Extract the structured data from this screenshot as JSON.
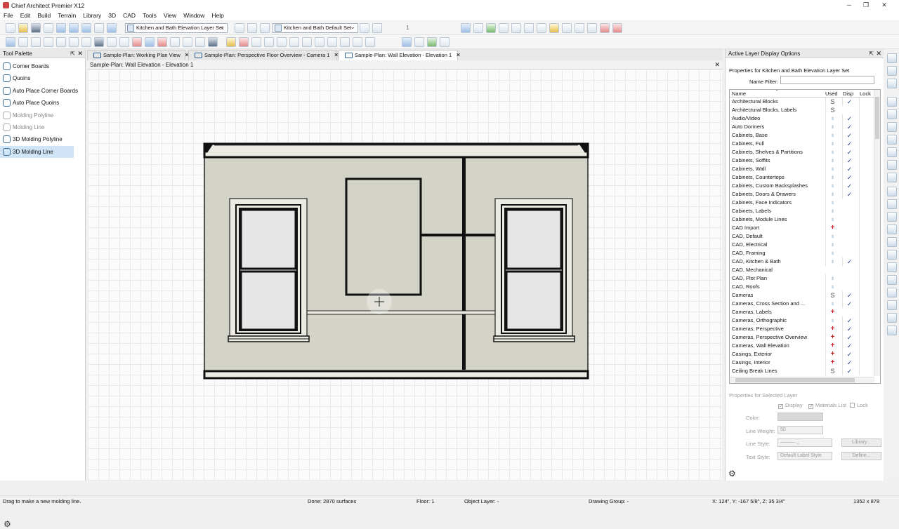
{
  "app": {
    "title": "Chief Architect Premier X12"
  },
  "menu": [
    "File",
    "Edit",
    "Build",
    "Terrain",
    "Library",
    "3D",
    "CAD",
    "Tools",
    "View",
    "Window",
    "Help"
  ],
  "toolbar": {
    "layer_set": "Kitchen and Bath Elevation Layer Set",
    "default_set": "Kitchen and Bath Default Set",
    "counter": "1"
  },
  "tool_palette": {
    "title": "Tool Palette",
    "items": [
      {
        "label": "Corner Boards",
        "state": "normal"
      },
      {
        "label": "Quoins",
        "state": "normal"
      },
      {
        "label": "Auto Place Corner Boards",
        "state": "normal"
      },
      {
        "label": "Auto Place Quoins",
        "state": "normal"
      },
      {
        "label": "Molding Polyline",
        "state": "disabled"
      },
      {
        "label": "Molding Line",
        "state": "disabled"
      },
      {
        "label": "3D Molding Polyline",
        "state": "normal"
      },
      {
        "label": "3D Molding Line",
        "state": "selected"
      }
    ]
  },
  "tabs": [
    {
      "label": "Sample-Plan: Working Plan View",
      "active": false
    },
    {
      "label": "Sample-Plan: Perspective Floor Overview - Camera 1",
      "active": false
    },
    {
      "label": "Sample-Plan: Wall Elevation - Elevation 1",
      "active": true
    }
  ],
  "view": {
    "title": "Sample-Plan: Wall Elevation - Elevation 1"
  },
  "layer_panel": {
    "title": "Active Layer Display Options",
    "properties_label": "Properties for Kitchen and Bath Elevation Layer Set",
    "name_filter_label": "Name Filter:",
    "name_filter_value": "",
    "columns": {
      "name": "Name",
      "used": "Used",
      "disp": "Disp",
      "lock": "Lock"
    },
    "rows": [
      {
        "name": "Architectural Blocks",
        "used": "S",
        "disp": true
      },
      {
        "name": "Architectural Blocks, Labels",
        "used": "S",
        "disp": false
      },
      {
        "name": "Audio/Video",
        "used": "bulb",
        "disp": true
      },
      {
        "name": "Auto Dormers",
        "used": "bulb",
        "disp": true
      },
      {
        "name": "Cabinets,  Base",
        "used": "bulb",
        "disp": true
      },
      {
        "name": "Cabinets,  Full",
        "used": "bulb",
        "disp": true
      },
      {
        "name": "Cabinets,  Shelves & Partitions",
        "used": "bulb",
        "disp": true
      },
      {
        "name": "Cabinets,  Soffits",
        "used": "bulb",
        "disp": true
      },
      {
        "name": "Cabinets,  Wall",
        "used": "bulb",
        "disp": true
      },
      {
        "name": "Cabinets, Countertops",
        "used": "bulb",
        "disp": true
      },
      {
        "name": "Cabinets, Custom Backsplashes",
        "used": "bulb",
        "disp": true
      },
      {
        "name": "Cabinets, Doors & Drawers",
        "used": "bulb",
        "disp": true
      },
      {
        "name": "Cabinets, Face Indicators",
        "used": "bulb",
        "disp": false
      },
      {
        "name": "Cabinets, Labels",
        "used": "bulb",
        "disp": false
      },
      {
        "name": "Cabinets, Module Lines",
        "used": "bulb",
        "disp": false
      },
      {
        "name": "CAD Import",
        "used": "plus",
        "disp": false
      },
      {
        "name": "CAD,  Default",
        "used": "bulb",
        "disp": false
      },
      {
        "name": "CAD, Electrical",
        "used": "bulb",
        "disp": false
      },
      {
        "name": "CAD, Framing",
        "used": "bulb",
        "disp": false
      },
      {
        "name": "CAD, Kitchen & Bath",
        "used": "bulb",
        "disp": true
      },
      {
        "name": "CAD, Mechanical",
        "used": "",
        "disp": false
      },
      {
        "name": "CAD, Plot Plan",
        "used": "bulb",
        "disp": false
      },
      {
        "name": "CAD, Roofs",
        "used": "bulb",
        "disp": false
      },
      {
        "name": "Cameras",
        "used": "S",
        "disp": true
      },
      {
        "name": "Cameras, Cross Section and ...",
        "used": "bulb",
        "disp": true
      },
      {
        "name": "Cameras, Labels",
        "used": "plus",
        "disp": false
      },
      {
        "name": "Cameras, Orthographic",
        "used": "bulb",
        "disp": true
      },
      {
        "name": "Cameras, Perspective",
        "used": "plus",
        "disp": true
      },
      {
        "name": "Cameras, Perspective Overview",
        "used": "plus",
        "disp": true
      },
      {
        "name": "Cameras, Wall Elevation",
        "used": "plus",
        "disp": true
      },
      {
        "name": "Casings, Exterior",
        "used": "plus",
        "disp": true
      },
      {
        "name": "Casings, Interior",
        "used": "plus",
        "disp": true
      },
      {
        "name": "Ceiling Break Lines",
        "used": "S",
        "disp": true
      }
    ],
    "selected_props": {
      "title": "Properties for Selected Layer",
      "display": "Display",
      "materials_list": "Materials List",
      "lock": "Lock",
      "color_label": "Color:",
      "line_weight_label": "Line Weight:",
      "line_weight_value": "50",
      "line_style_label": "Line Style:",
      "library_button": "Library...",
      "text_style_label": "Text Style:",
      "text_style_value": "Default Label Style",
      "define_button": "Define..."
    }
  },
  "status": {
    "hint": "Drag to make a new molding line.",
    "done": "Done:  2870 surfaces",
    "floor": "Floor: 1",
    "object_layer": "Object Layer: -",
    "drawing_group": "Drawing Group: -",
    "coords": "X: 124\", Y: -167 5/8\", Z: 35 3/4\"",
    "size": "1352 x 878"
  },
  "icons": {
    "settings": "gear-icon",
    "close": "close-icon",
    "pin": "pin-icon",
    "cursor": "crosshair-icon"
  },
  "colors": {
    "wall_fill": "#d4d3c7",
    "check_blue": "#1c3f8a",
    "plus_red": "#c42020",
    "selection": "#cfe4f7"
  }
}
